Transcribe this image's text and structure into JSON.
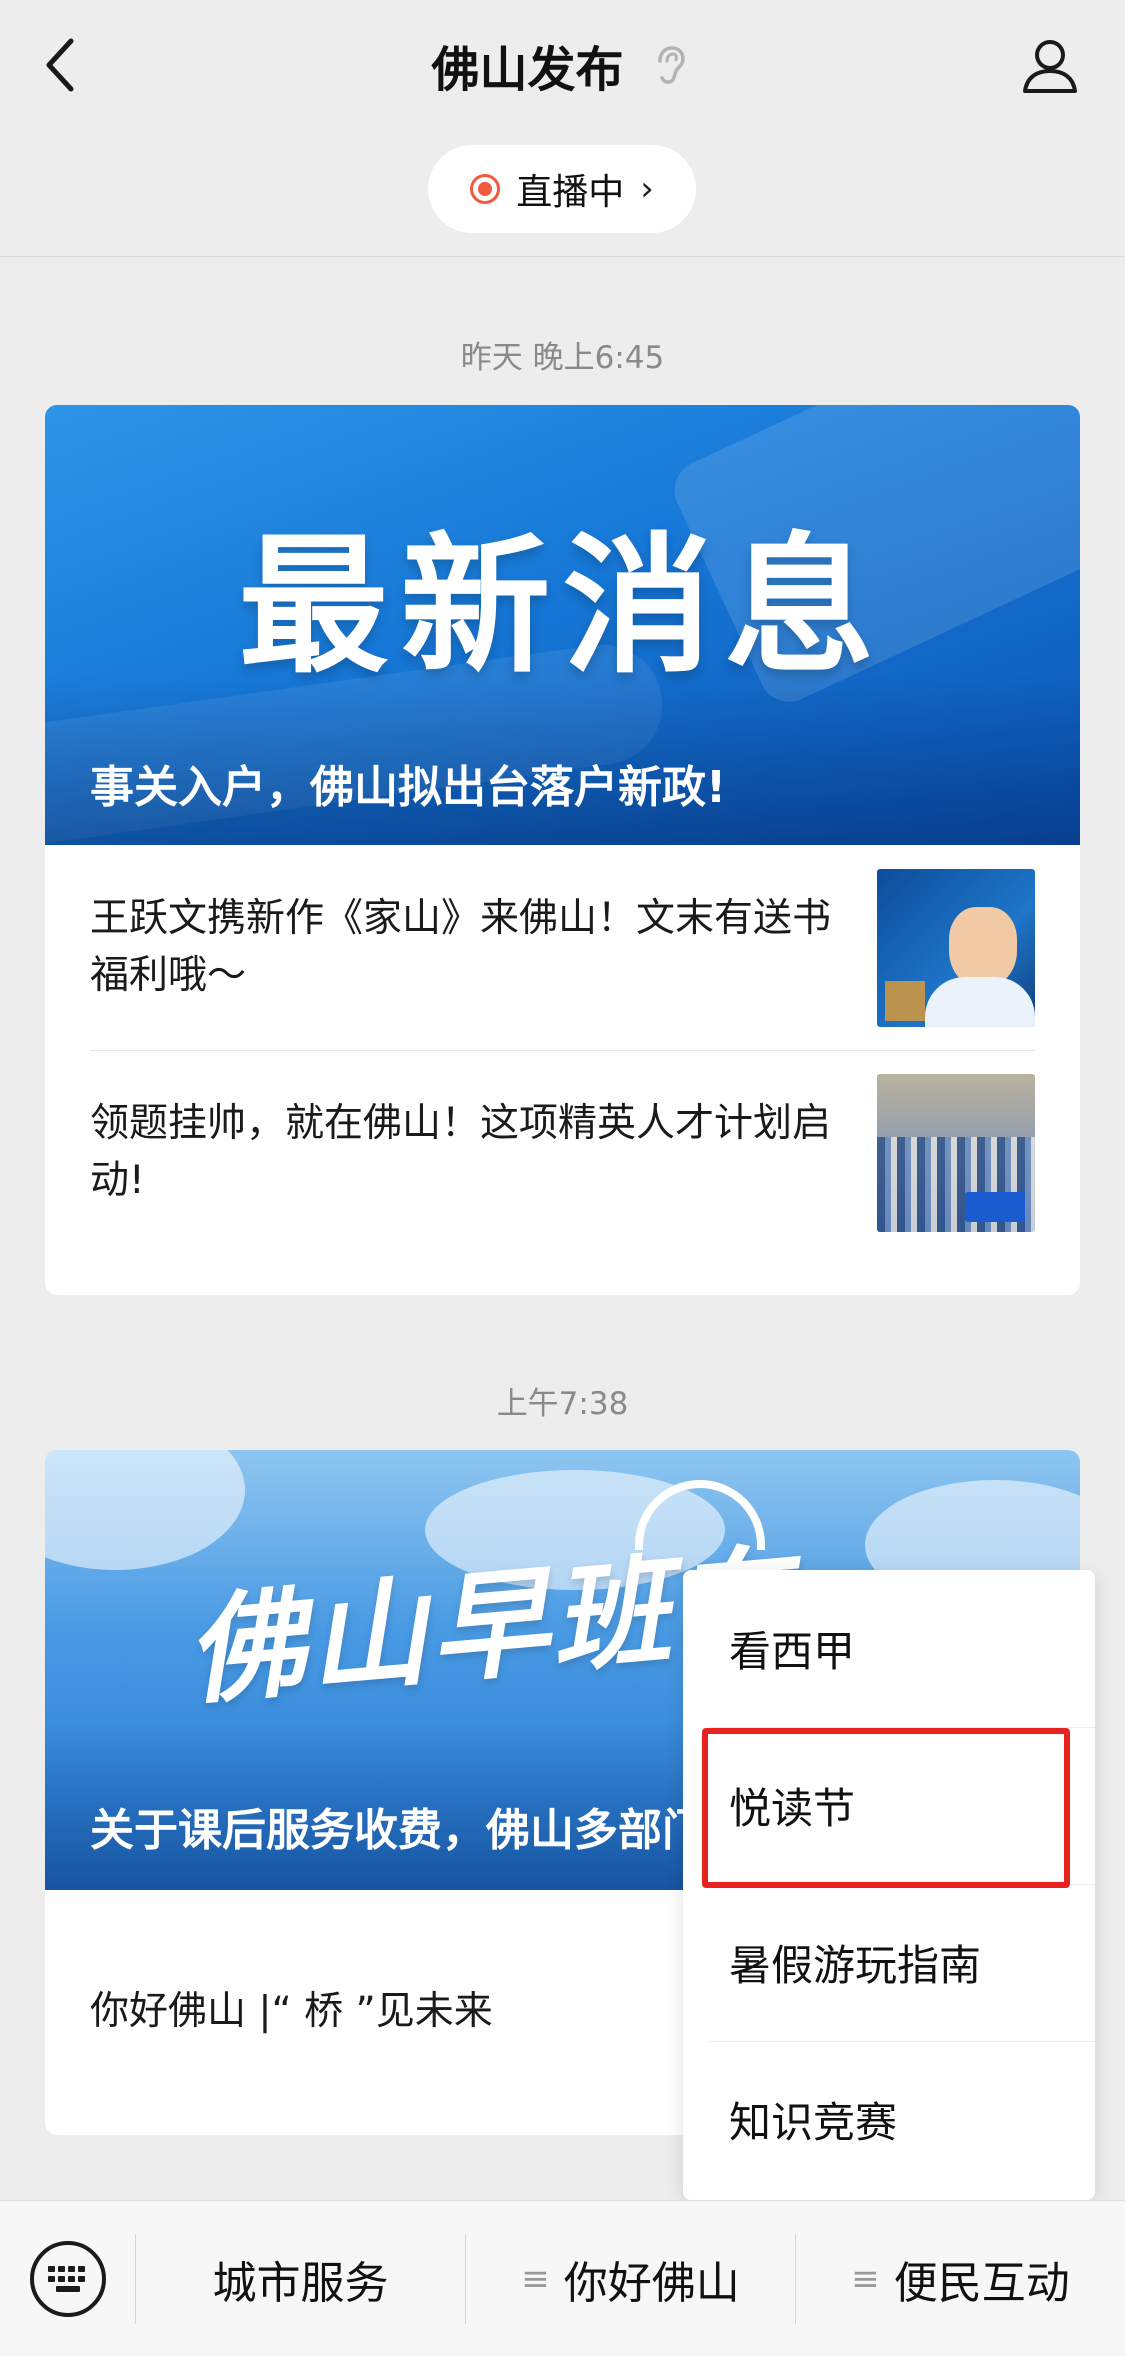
{
  "header": {
    "title": "佛山发布",
    "back_icon": "chevron-left-icon",
    "listen_icon": "ear-icon",
    "profile_icon": "person-icon"
  },
  "live": {
    "label": "直播中",
    "chevron": "›",
    "accent": "#f05a3a"
  },
  "messages": [
    {
      "timestamp": "昨天 晚上6:45",
      "cover_headline": "最新消息",
      "cover_caption": "事关入户，佛山拟出台落户新政!",
      "items": [
        {
          "title": "王跃文携新作《家山》来佛山！文末有送书福利哦～"
        },
        {
          "title": "领题挂帅，就在佛山！这项精英人才计划启动!"
        }
      ]
    },
    {
      "timestamp": "上午7:38",
      "cover_headline": "佛山早班车",
      "cover_caption": "关于课后服务收费，佛山多部门回应|佛山早班车",
      "items": [
        {
          "title": "你好佛山 |“ 桥 ”见未来"
        }
      ]
    }
  ],
  "popup_menu": {
    "items": [
      "看西甲",
      "悦读节",
      "暑假游玩指南",
      "知识竞赛"
    ],
    "highlighted": "悦读节"
  },
  "bottom_bar": {
    "keyboard_icon": "keyboard-icon",
    "menus": [
      {
        "label": "城市服务",
        "has_submenu": false
      },
      {
        "label": "你好佛山",
        "has_submenu": true
      },
      {
        "label": "便民互动",
        "has_submenu": true,
        "highlighted": true
      }
    ],
    "submenu_glyph": "≡"
  },
  "colors": {
    "highlight": "#e8231f",
    "background": "#ededed"
  }
}
